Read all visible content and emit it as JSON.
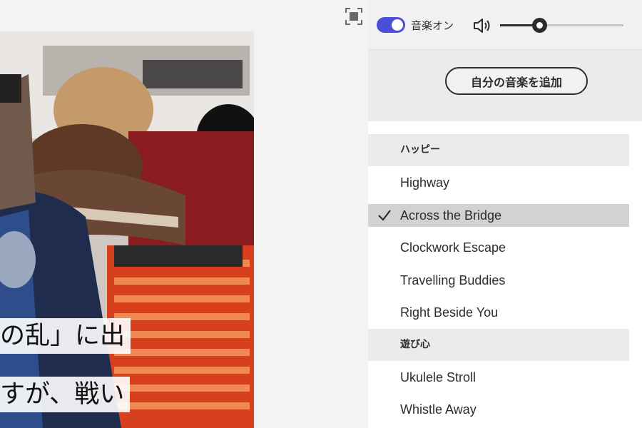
{
  "preview": {
    "captions": [
      "の乱」に出",
      "すが、戦い"
    ]
  },
  "controls": {
    "music_toggle_on": true,
    "music_label": "音楽オン",
    "volume_level": 0.32
  },
  "add_music_label": "自分の音楽を追加",
  "categories": [
    {
      "name": "ハッピー",
      "tracks": [
        "Highway",
        "Across the Bridge",
        "Clockwork Escape",
        "Travelling Buddies",
        "Right Beside You"
      ]
    },
    {
      "name": "遊び心",
      "tracks": [
        "Ukulele Stroll",
        "Whistle Away"
      ]
    }
  ],
  "selected_track": "Across the Bridge",
  "icons": {
    "fullscreen": "fullscreen-icon",
    "speaker": "speaker-volume-icon",
    "check": "checkmark-icon"
  },
  "colors": {
    "toggle_accent": "#4b4ed8",
    "selected_row": "#d2d2d2",
    "category_header": "#ebebeb"
  }
}
